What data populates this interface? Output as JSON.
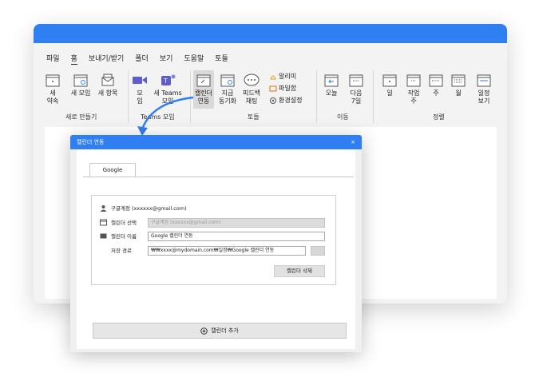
{
  "menu": [
    "파일",
    "홈",
    "보내기/받기",
    "폴더",
    "보기",
    "도움말",
    "토들"
  ],
  "ribbon": {
    "new_group": {
      "label": "새로 만들기",
      "buttons": [
        "새\n약속",
        "새 모임",
        "새 항목"
      ]
    },
    "teams_group": {
      "label": "Teams 모임",
      "buttons": [
        "모\n임",
        "새 Teams\n모임"
      ]
    },
    "todle_group": {
      "label": "토들",
      "buttons": [
        "캘린더\n연동",
        "지금\n동기화",
        "피드백\n채팅"
      ],
      "small": [
        "알리미",
        "파일함",
        "환경설정"
      ]
    },
    "move_group": {
      "label": "이동",
      "buttons": [
        "오늘",
        "다음\n7일"
      ]
    },
    "view_group": {
      "label": "정렬",
      "buttons": [
        "일",
        "작업\n주",
        "주",
        "월",
        "일정\n보기"
      ]
    }
  },
  "dialog": {
    "title": "캘린더 연동",
    "close": "×",
    "tab": "Google",
    "account_label": "구글계정 (xxxxxx@gmail.com)",
    "calendar_select_label": "캘린더 선택",
    "calendar_select_value": "구글계정 (xxxxxx@gmail.com)",
    "calendar_name_label": "캘린더 이름",
    "calendar_name_value": "Google 캘린더 연동",
    "save_path_label": "저장 경로",
    "save_path_value": "₩₩xxxx@mydomain.com₩일정₩Google 캘린더 연동",
    "delete_button": "캘린더 삭제",
    "add_button": "캘린더 추가"
  },
  "colors": {
    "accent": "#2f7ef2",
    "arrow": "#2f7ef2",
    "teams": "#5b5fc7"
  }
}
